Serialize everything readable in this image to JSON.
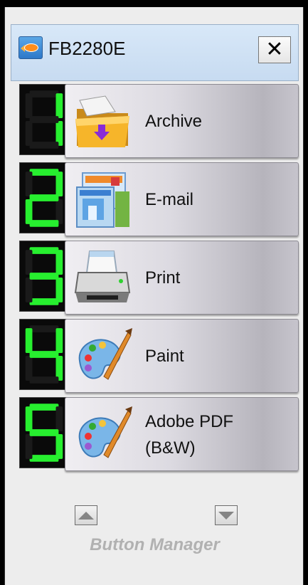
{
  "window": {
    "title": "FB2280E",
    "app_icon": "fish-icon",
    "close_label": "✕"
  },
  "buttons": [
    {
      "number": 1,
      "label": "Archive",
      "icon": "archive-folder-icon"
    },
    {
      "number": 2,
      "label": "E-mail",
      "icon": "email-icon"
    },
    {
      "number": 3,
      "label": "Print",
      "icon": "printer-icon"
    },
    {
      "number": 4,
      "label": "Paint",
      "icon": "paint-palette-icon"
    },
    {
      "number": 5,
      "label": "Adobe PDF\n(B&W)",
      "icon": "paint-palette-icon"
    }
  ],
  "nav": {
    "up_icon": "scroll-up-icon",
    "down_icon": "scroll-down-icon"
  },
  "footer": {
    "label": "Button Manager"
  },
  "colors": {
    "digit_on": "#27ef2f",
    "digit_off": "#1a1a1a",
    "titlebar": "#cfe1f4",
    "panel": "#ededed"
  }
}
